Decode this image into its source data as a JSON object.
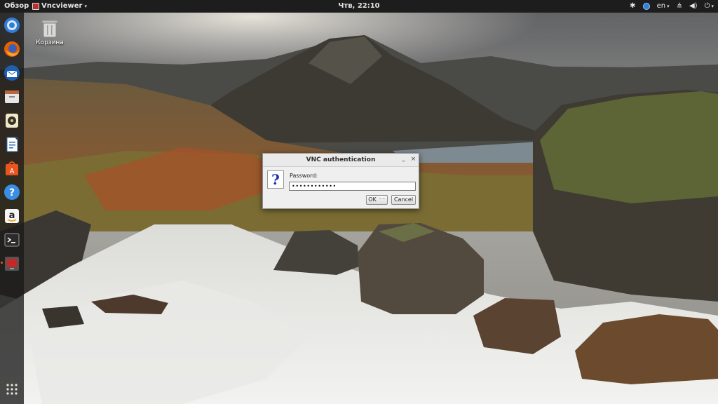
{
  "topbar": {
    "activities_label": "Обзор",
    "app_menu_label": "Vncviewer",
    "clock": "Чтв, 22:10",
    "language": "en"
  },
  "dock": {
    "items": [
      {
        "name": "chromium-browser",
        "icon": "chromium-icon"
      },
      {
        "name": "firefox",
        "icon": "firefox-icon"
      },
      {
        "name": "thunderbird",
        "icon": "thunderbird-icon"
      },
      {
        "name": "files",
        "icon": "files-icon"
      },
      {
        "name": "rhythmbox",
        "icon": "rhythmbox-icon"
      },
      {
        "name": "libreoffice-writer",
        "icon": "writer-icon"
      },
      {
        "name": "ubuntu-software",
        "icon": "software-icon"
      },
      {
        "name": "help",
        "icon": "help-icon"
      },
      {
        "name": "amazon",
        "icon": "amazon-icon"
      },
      {
        "name": "terminal",
        "icon": "terminal-icon"
      },
      {
        "name": "vncviewer",
        "icon": "vncviewer-icon"
      }
    ],
    "show_apps_icon": "grid-icon"
  },
  "desktop": {
    "trash_label": "Корзина"
  },
  "dialog": {
    "title": "VNC authentication",
    "password_label": "Password:",
    "password_value": "••••••••••••",
    "ok_label": "OK",
    "ok_hint": "^^",
    "cancel_label": "Cancel",
    "icon_glyph": "?"
  },
  "colors": {
    "topbar_bg": "#1d1d1d",
    "dock_bg": "#191919",
    "dialog_bg": "#efefef",
    "question_mark": "#1a2fae"
  }
}
